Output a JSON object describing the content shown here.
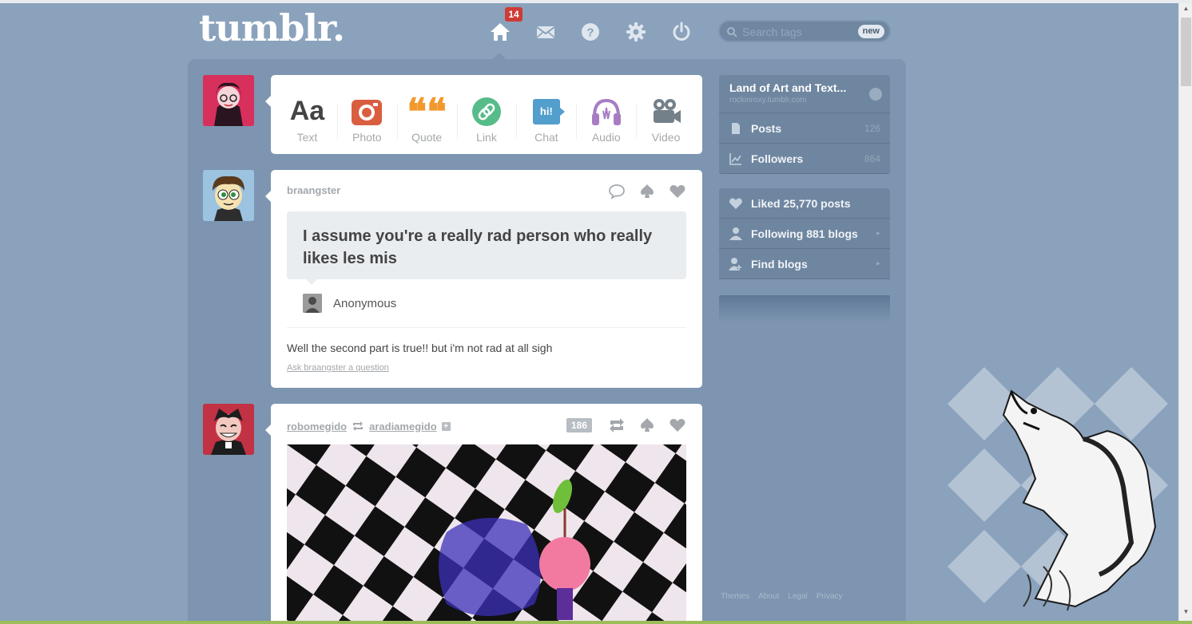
{
  "brand": {
    "logo": "tumblr."
  },
  "nav": {
    "inbox_count": "14",
    "items": [
      "home-icon",
      "mail-icon",
      "help-icon",
      "settings-icon",
      "power-icon"
    ]
  },
  "search": {
    "placeholder": "Search tags",
    "new_label": "new"
  },
  "post_types": [
    {
      "label": "Text",
      "glyph": "Aa",
      "color": "#444444"
    },
    {
      "label": "Photo",
      "color": "#d95e40"
    },
    {
      "label": "Quote",
      "glyph": "❝❝",
      "color": "#f2992e"
    },
    {
      "label": "Link",
      "color": "#56bc8a"
    },
    {
      "label": "Chat",
      "glyph": "hi!",
      "color": "#529ecc"
    },
    {
      "label": "Audio",
      "color": "#a77dc2"
    },
    {
      "label": "Video",
      "color": "#748089"
    }
  ],
  "posts": [
    {
      "author": "braangster",
      "question": "I assume you're a really rad person who really likes les mis",
      "asker": "Anonymous",
      "answer": "Well the second part is true!! but i'm not rad at all sigh",
      "ask_link": "Ask braangster a question"
    },
    {
      "author": "robomegido",
      "reblogged_from": "aradiamegido",
      "notes": "186"
    }
  ],
  "sidebar": {
    "blog_title": "Land of Art and Text...",
    "blog_url": "rockinroxy.tumblr.com",
    "posts_label": "Posts",
    "posts_count": "126",
    "followers_label": "Followers",
    "followers_count": "864",
    "liked_label": "Liked 25,770 posts",
    "following_label": "Following 881 blogs",
    "find_label": "Find blogs"
  },
  "footer": {
    "themes": "Themes",
    "about": "About",
    "legal": "Legal",
    "privacy": "Privacy"
  }
}
